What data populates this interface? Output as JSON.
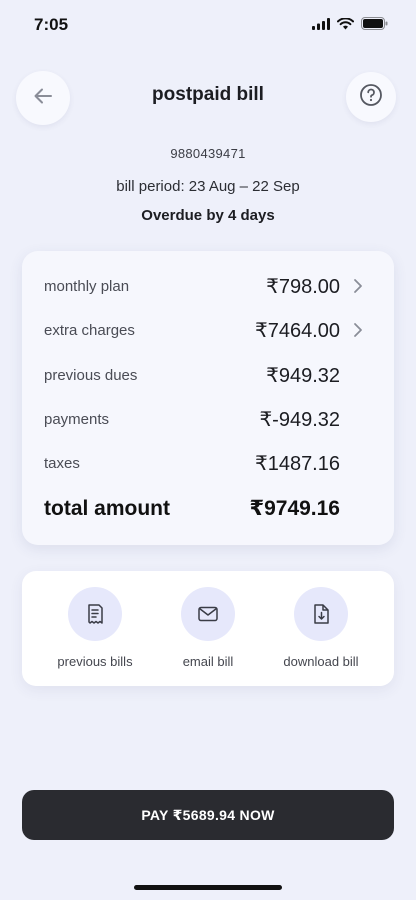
{
  "status_bar": {
    "time": "7:05"
  },
  "header": {
    "title": "postpaid bill",
    "back_icon": "arrow-left-icon",
    "help_icon": "help-circle-icon"
  },
  "account": {
    "phone_number": "9880439471",
    "bill_period": "bill period: 23 Aug – 22 Sep",
    "overdue": "Overdue by 4 days"
  },
  "summary": {
    "rows": [
      {
        "label": "monthly plan",
        "value": "₹798.00"
      },
      {
        "label": "extra charges",
        "value": "₹7464.00"
      },
      {
        "label": "previous dues",
        "value": "₹949.32"
      },
      {
        "label": "payments",
        "value": "₹-949.32"
      },
      {
        "label": "taxes",
        "value": "₹1487.16"
      }
    ],
    "total": {
      "label": "total amount",
      "value": "₹9749.16"
    }
  },
  "actions": [
    {
      "label": "previous bills",
      "icon": "receipt-icon"
    },
    {
      "label": "email bill",
      "icon": "mail-icon"
    },
    {
      "label": "download bill",
      "icon": "file-download-icon"
    }
  ],
  "pay_button": {
    "label": "PAY ₹5689.94 NOW"
  },
  "colors": {
    "background": "#eef0fa",
    "card": "#f6f7fd",
    "icon_bg": "#e6e8fb",
    "pay_button": "#2a2b30"
  }
}
